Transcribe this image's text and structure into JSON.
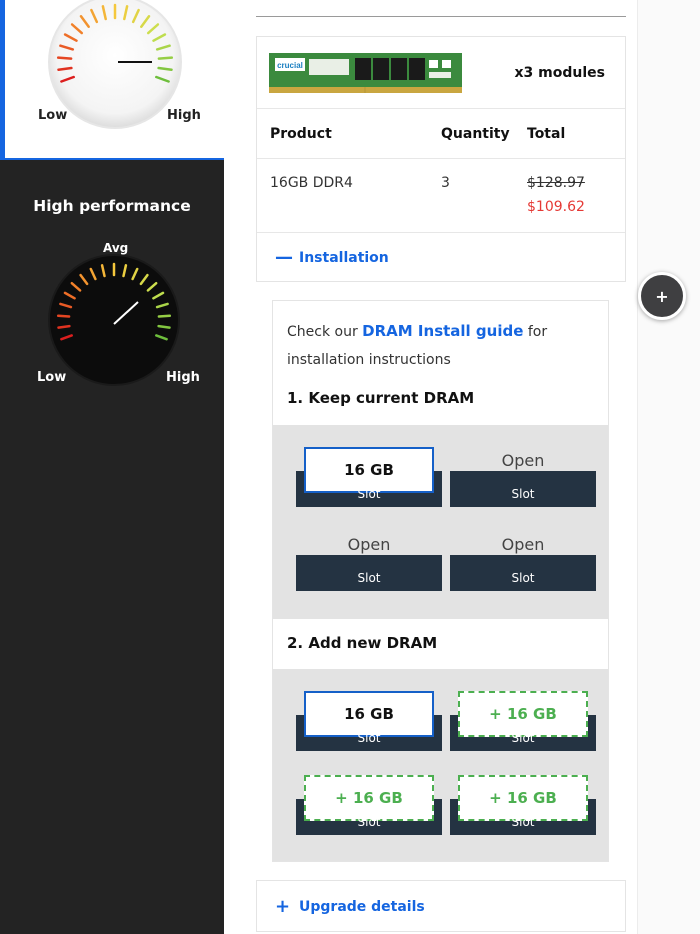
{
  "gauges": {
    "white": {
      "low_label": "Low",
      "high_label": "High"
    },
    "dark": {
      "title": "High performance",
      "avg_label": "Avg",
      "low_label": "Low",
      "high_label": "High"
    }
  },
  "order": {
    "module_count": "x3 modules",
    "headers": {
      "product": "Product",
      "quantity": "Quantity",
      "total": "Total"
    },
    "row": {
      "product": "16GB DDR4",
      "quantity": "3",
      "old_price": "$128.97",
      "new_price": "$109.62"
    },
    "installation_toggle": {
      "icon": "minus-icon",
      "glyph": "—",
      "label": "Installation"
    },
    "ram_brand": "crucial"
  },
  "install": {
    "text_before": "Check our ",
    "guide_link": "DRAM Install guide",
    "text_after": " for installation instructions",
    "keep_title": "1. Keep current DRAM",
    "add_title": "2. Add new DRAM",
    "slot_caption": "Slot",
    "keep_slots": [
      "16 GB",
      "Open",
      "Open",
      "Open"
    ],
    "add_slots": [
      "16 GB",
      "+ 16 GB",
      "+ 16 GB",
      "+ 16 GB"
    ]
  },
  "upgrade_toggle": {
    "icon": "plus-icon",
    "glyph": "+",
    "label": "Upgrade details"
  },
  "fab": {
    "icon": "plus-icon",
    "glyph": "+"
  },
  "colors": {
    "accent": "#1565e0",
    "sale": "#e53935",
    "new_module": "#4caf50",
    "slot": "#243342"
  }
}
